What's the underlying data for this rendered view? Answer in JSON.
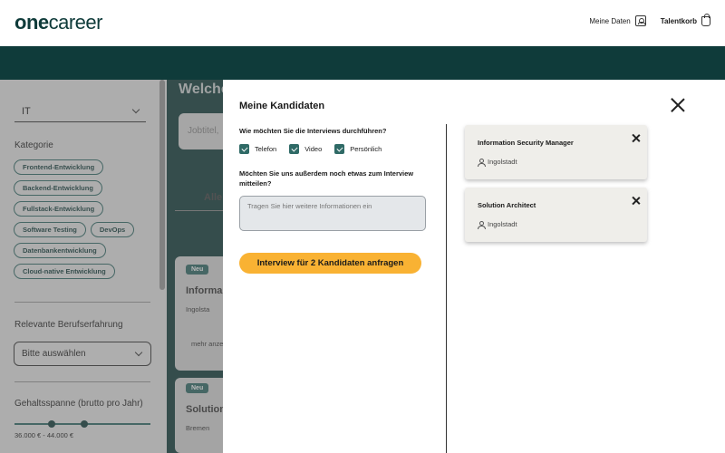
{
  "header": {
    "logo_part1": "one",
    "logo_part2": "career",
    "my_data": "Meine Daten",
    "cart": "Talentkorb"
  },
  "sidebar": {
    "field_value": "IT",
    "category_heading": "Kategorie",
    "chips": [
      "Frontend-Entwicklung",
      "Backend-Entwicklung",
      "Fullstack-Entwicklung",
      "Software Testing",
      "DevOps",
      "Datenbankentwicklung",
      "Cloud-native Entwicklung"
    ],
    "experience_heading": "Relevante Berufserfahrung",
    "experience_value": "Bitte auswählen",
    "salary_heading": "Gehaltsspanne (brutto pro Jahr)",
    "salary_range": "36.000 € - 44.000 €"
  },
  "background": {
    "title": "Welche",
    "search_placeholder": "Jobtitel,",
    "tab": "Alle (",
    "cards": [
      {
        "badge": "Neu",
        "title": "Informa",
        "location": "Ingolsta",
        "more": "mehr anze"
      },
      {
        "badge": "Neu",
        "title": "Solution",
        "location": "Bremen"
      }
    ]
  },
  "modal": {
    "title": "Meine Kandidaten",
    "question_interview": "Wie möchten Sie die Interviews durchführen?",
    "options": [
      {
        "label": "Telefon",
        "checked": true
      },
      {
        "label": "Video",
        "checked": true
      },
      {
        "label": "Persönlich",
        "checked": true
      }
    ],
    "question_more": "Möchten Sie uns außerdem noch etwas zum Interview mitteilen?",
    "textarea_placeholder": "Tragen Sie hier weitere Informationen ein",
    "cta": "Interview für 2 Kandidaten anfragen",
    "candidates": [
      {
        "title": "Information Security Manager",
        "location": "Ingolstadt"
      },
      {
        "title": "Solution Architect",
        "location": "Ingolstadt"
      }
    ]
  },
  "colors": {
    "brand_dark": "#0f3b3a",
    "accent_teal": "#2f6a66",
    "cta_yellow": "#f9b233"
  }
}
